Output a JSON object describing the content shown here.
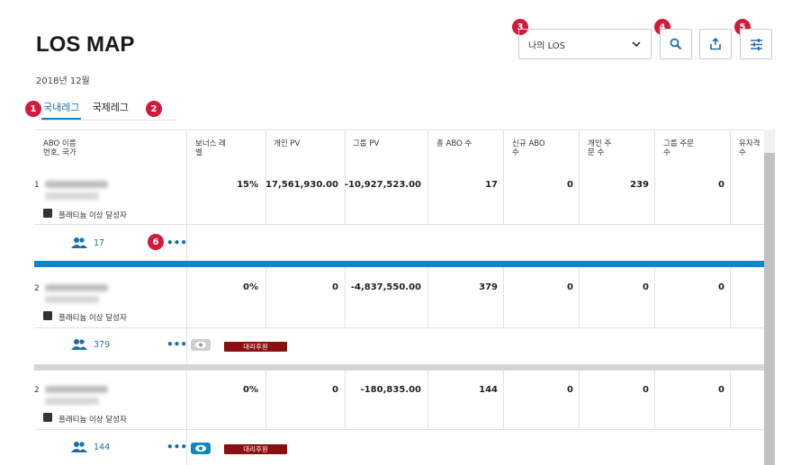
{
  "page": {
    "title": "LOS MAP",
    "date": "2018년 12월"
  },
  "markers": [
    "1",
    "2",
    "3",
    "4",
    "5",
    "6"
  ],
  "tabs": [
    {
      "label": "국내레그",
      "active": true
    },
    {
      "label": "국제레그",
      "active": false
    }
  ],
  "filter": {
    "selected": "나의 LOS"
  },
  "toolbar": {
    "search_icon": "search-icon",
    "export_icon": "export-icon",
    "settings_icon": "sliders-icon"
  },
  "table": {
    "columns": [
      "ABO 이름\n번호, 국가",
      "보너스 레\n벨",
      "개인 PV",
      "그룹 PV",
      "총 ABO 수",
      "신규 ABO\n수",
      "개인 주\n문 수",
      "그룹 주문\n수",
      "유자격\n수"
    ],
    "rows": [
      {
        "rank": "1",
        "badge_text": "플래티늄 이상 달성자",
        "bonus": "15%",
        "personal_pv": "17,561,930.00",
        "group_pv": "-10,927,523.00",
        "total_abo": "17",
        "new_abo": "0",
        "personal_orders": "239",
        "group_orders": "0",
        "people": "17",
        "status_badge": ""
      },
      {
        "rank": "2",
        "badge_text": "플래티늄 이상 달성자",
        "bonus": "0%",
        "personal_pv": "0",
        "group_pv": "-4,837,550.00",
        "total_abo": "379",
        "new_abo": "0",
        "personal_orders": "0",
        "group_orders": "0",
        "people": "379",
        "status_badge": "대리후원"
      },
      {
        "rank": "2",
        "badge_text": "플래티늄 이상 달성자",
        "bonus": "0%",
        "personal_pv": "0",
        "group_pv": "-180,835.00",
        "total_abo": "144",
        "new_abo": "0",
        "personal_orders": "0",
        "group_orders": "0",
        "people": "144",
        "status_badge": "대리후원"
      }
    ]
  },
  "colors": {
    "accent": "#0f85c6",
    "marker": "#d11a3c",
    "badge": "#8b0e10"
  }
}
